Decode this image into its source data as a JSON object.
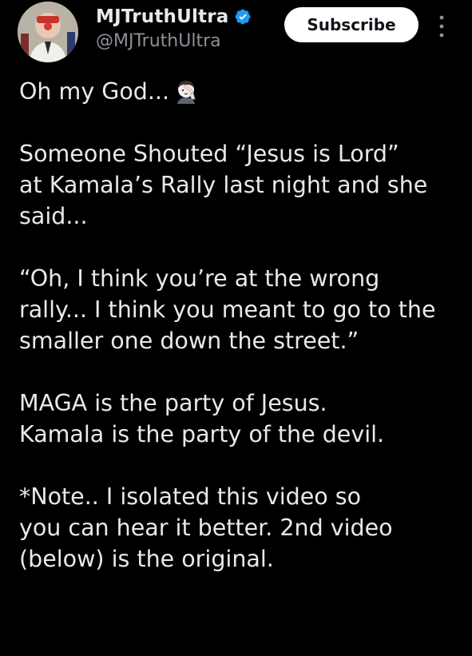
{
  "user": {
    "display_name": "MJTruthUltra",
    "handle": "@MJTruthUltra",
    "verified": true,
    "verified_color": "#1d9bf0"
  },
  "actions": {
    "subscribe_label": "Subscribe",
    "more_icon": "more-vertical-icon"
  },
  "tweet": {
    "paragraphs": [
      {
        "lines": [
          "Oh my God..."
        ],
        "emoji": "facepalm-emoji"
      },
      {
        "lines": [
          "Someone Shouted “Jesus is Lord”",
          "at Kamala’s Rally last night and she",
          "said..."
        ]
      },
      {
        "lines": [
          "“Oh, I think you’re at the wrong",
          "rally... I think you meant to go to the",
          "smaller one down the street.”"
        ]
      },
      {
        "lines": [
          "MAGA is the party of Jesus.",
          "Kamala is the party of the devil."
        ]
      },
      {
        "lines": [
          "*Note.. I isolated this video so",
          "you can hear it better. 2nd video",
          "(below) is the original."
        ]
      }
    ]
  },
  "colors": {
    "background": "#000000",
    "text": "#e7e9ea",
    "secondary_text": "#8b9198",
    "button_bg": "#ffffff",
    "button_text": "#0f1419"
  }
}
